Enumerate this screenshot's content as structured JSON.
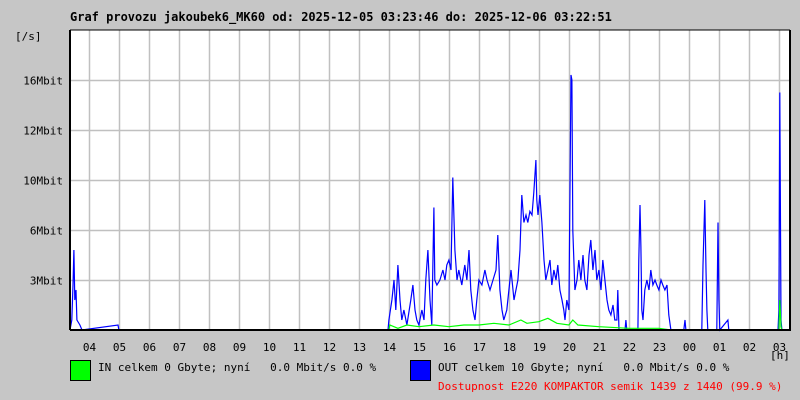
{
  "chart_data": {
    "type": "line",
    "title": "Graf provozu jakoubek6_MK60 od: 2025-12-05 03:23:46 do: 2025-12-06 03:22:51",
    "ylabel": "[/s]",
    "xlabel": "[h]",
    "y_ticks": [
      {
        "value": 3,
        "label": "3Mbit"
      },
      {
        "value": 6,
        "label": "6Mbit"
      },
      {
        "value": 10,
        "label": "10Mbit"
      },
      {
        "value": 12,
        "label": "12Mbit"
      },
      {
        "value": 16,
        "label": "16Mbit"
      }
    ],
    "y_scale_breaks": [
      0,
      3,
      6,
      10,
      12,
      16,
      20
    ],
    "x_range_hours": [
      3.37,
      27.37
    ],
    "x_ticks": [
      {
        "t": 4,
        "label": "04"
      },
      {
        "t": 5,
        "label": "05"
      },
      {
        "t": 6,
        "label": "06"
      },
      {
        "t": 7,
        "label": "07"
      },
      {
        "t": 8,
        "label": "08"
      },
      {
        "t": 9,
        "label": "09"
      },
      {
        "t": 10,
        "label": "10"
      },
      {
        "t": 11,
        "label": "11"
      },
      {
        "t": 12,
        "label": "12"
      },
      {
        "t": 13,
        "label": "13"
      },
      {
        "t": 14,
        "label": "14"
      },
      {
        "t": 15,
        "label": "15"
      },
      {
        "t": 16,
        "label": "16"
      },
      {
        "t": 17,
        "label": "17"
      },
      {
        "t": 18,
        "label": "18"
      },
      {
        "t": 19,
        "label": "19"
      },
      {
        "t": 20,
        "label": "20"
      },
      {
        "t": 21,
        "label": "21"
      },
      {
        "t": 22,
        "label": "22"
      },
      {
        "t": 23,
        "label": "23"
      },
      {
        "t": 24,
        "label": "00"
      },
      {
        "t": 25,
        "label": "01"
      },
      {
        "t": 26,
        "label": "02"
      },
      {
        "t": 27,
        "label": "03"
      }
    ],
    "grid": true,
    "series": [
      {
        "name": "OUT",
        "color": "#0000ff",
        "unit": "Mbit/s",
        "points": [
          [
            3.37,
            0
          ],
          [
            3.43,
            0.6
          ],
          [
            3.47,
            2.7
          ],
          [
            3.5,
            4.8
          ],
          [
            3.53,
            1.8
          ],
          [
            3.57,
            2.4
          ],
          [
            3.6,
            0.6
          ],
          [
            3.7,
            0.3
          ],
          [
            3.77,
            0
          ],
          [
            4.97,
            0.3
          ],
          [
            5.0,
            0
          ],
          [
            13.97,
            0
          ],
          [
            14.0,
            0.6
          ],
          [
            14.1,
            1.8
          ],
          [
            14.17,
            3.0
          ],
          [
            14.23,
            1.2
          ],
          [
            14.3,
            3.9
          ],
          [
            14.37,
            1.8
          ],
          [
            14.43,
            0.6
          ],
          [
            14.5,
            1.2
          ],
          [
            14.6,
            0.3
          ],
          [
            14.73,
            1.8
          ],
          [
            14.8,
            2.7
          ],
          [
            14.87,
            1.2
          ],
          [
            14.93,
            0.6
          ],
          [
            15.0,
            0.3
          ],
          [
            15.1,
            1.2
          ],
          [
            15.17,
            0.6
          ],
          [
            15.23,
            3.0
          ],
          [
            15.3,
            4.8
          ],
          [
            15.37,
            1.8
          ],
          [
            15.43,
            0.3
          ],
          [
            15.5,
            7.8
          ],
          [
            15.53,
            3.0
          ],
          [
            15.6,
            2.7
          ],
          [
            15.7,
            3.0
          ],
          [
            15.8,
            3.6
          ],
          [
            15.87,
            3.0
          ],
          [
            15.93,
            3.9
          ],
          [
            16.0,
            4.2
          ],
          [
            16.07,
            3.6
          ],
          [
            16.13,
            10.1
          ],
          [
            16.2,
            4.8
          ],
          [
            16.27,
            3.0
          ],
          [
            16.33,
            3.6
          ],
          [
            16.43,
            2.7
          ],
          [
            16.53,
            3.9
          ],
          [
            16.6,
            3.0
          ],
          [
            16.67,
            4.8
          ],
          [
            16.73,
            2.4
          ],
          [
            16.8,
            1.2
          ],
          [
            16.87,
            0.6
          ],
          [
            16.93,
            1.8
          ],
          [
            17.0,
            3.0
          ],
          [
            17.1,
            2.7
          ],
          [
            17.2,
            3.6
          ],
          [
            17.27,
            3.0
          ],
          [
            17.37,
            2.4
          ],
          [
            17.47,
            3.0
          ],
          [
            17.57,
            3.6
          ],
          [
            17.63,
            5.7
          ],
          [
            17.7,
            2.4
          ],
          [
            17.77,
            1.2
          ],
          [
            17.83,
            0.6
          ],
          [
            17.93,
            1.2
          ],
          [
            18.0,
            2.4
          ],
          [
            18.07,
            3.6
          ],
          [
            18.17,
            1.8
          ],
          [
            18.3,
            3.0
          ],
          [
            18.37,
            4.8
          ],
          [
            18.43,
            8.8
          ],
          [
            18.5,
            6.6
          ],
          [
            18.57,
            7.2
          ],
          [
            18.63,
            6.6
          ],
          [
            18.7,
            7.5
          ],
          [
            18.77,
            7.2
          ],
          [
            18.83,
            9.0
          ],
          [
            18.9,
            10.8
          ],
          [
            18.93,
            8.4
          ],
          [
            18.97,
            7.2
          ],
          [
            19.03,
            8.8
          ],
          [
            19.1,
            6.6
          ],
          [
            19.17,
            4.2
          ],
          [
            19.23,
            3.0
          ],
          [
            19.3,
            3.6
          ],
          [
            19.37,
            4.2
          ],
          [
            19.43,
            2.7
          ],
          [
            19.5,
            3.6
          ],
          [
            19.57,
            3.0
          ],
          [
            19.63,
            3.9
          ],
          [
            19.7,
            2.4
          ],
          [
            19.77,
            1.8
          ],
          [
            19.83,
            1.2
          ],
          [
            19.87,
            0.6
          ],
          [
            19.93,
            1.8
          ],
          [
            20.0,
            1.2
          ],
          [
            20.07,
            16.4
          ],
          [
            20.1,
            16.0
          ],
          [
            20.13,
            6.0
          ],
          [
            20.2,
            2.4
          ],
          [
            20.27,
            3.0
          ],
          [
            20.33,
            4.2
          ],
          [
            20.4,
            3.0
          ],
          [
            20.47,
            4.5
          ],
          [
            20.53,
            3.0
          ],
          [
            20.6,
            2.4
          ],
          [
            20.67,
            4.5
          ],
          [
            20.73,
            5.4
          ],
          [
            20.8,
            3.6
          ],
          [
            20.87,
            4.8
          ],
          [
            20.93,
            3.0
          ],
          [
            21.0,
            3.6
          ],
          [
            21.07,
            2.4
          ],
          [
            21.13,
            4.2
          ],
          [
            21.2,
            3.0
          ],
          [
            21.27,
            1.8
          ],
          [
            21.33,
            1.2
          ],
          [
            21.4,
            0.9
          ],
          [
            21.47,
            1.5
          ],
          [
            21.53,
            0.6
          ],
          [
            21.6,
            0.6
          ],
          [
            21.63,
            2.4
          ],
          [
            21.67,
            0
          ],
          [
            21.87,
            0
          ],
          [
            21.9,
            0.6
          ],
          [
            21.93,
            0
          ],
          [
            22.3,
            0
          ],
          [
            22.33,
            4.2
          ],
          [
            22.37,
            8.0
          ],
          [
            22.4,
            5.0
          ],
          [
            22.43,
            1.2
          ],
          [
            22.47,
            0.6
          ],
          [
            22.53,
            2.4
          ],
          [
            22.6,
            3.0
          ],
          [
            22.67,
            2.4
          ],
          [
            22.73,
            3.6
          ],
          [
            22.8,
            2.7
          ],
          [
            22.87,
            3.0
          ],
          [
            22.93,
            2.7
          ],
          [
            23.0,
            2.4
          ],
          [
            23.07,
            3.0
          ],
          [
            23.13,
            2.7
          ],
          [
            23.2,
            2.4
          ],
          [
            23.27,
            2.7
          ],
          [
            23.33,
            0.9
          ],
          [
            23.4,
            0
          ],
          [
            23.83,
            0
          ],
          [
            23.87,
            0.6
          ],
          [
            23.9,
            0
          ],
          [
            24.43,
            0
          ],
          [
            24.47,
            3.9
          ],
          [
            24.53,
            8.4
          ],
          [
            24.57,
            3.6
          ],
          [
            24.6,
            1.2
          ],
          [
            24.63,
            0
          ],
          [
            24.93,
            0
          ],
          [
            24.97,
            6.6
          ],
          [
            25.0,
            1.8
          ],
          [
            25.03,
            0
          ],
          [
            25.3,
            0.6
          ],
          [
            25.33,
            0
          ],
          [
            26.97,
            0
          ],
          [
            27.0,
            1.2
          ],
          [
            27.03,
            15.0
          ],
          [
            27.07,
            0.6
          ],
          [
            27.1,
            0
          ]
        ]
      },
      {
        "name": "IN",
        "color": "#00ff00",
        "unit": "Mbit/s",
        "points": [
          [
            3.37,
            0
          ],
          [
            14.0,
            0
          ],
          [
            14.03,
            0.3
          ],
          [
            14.3,
            0.1
          ],
          [
            14.6,
            0.3
          ],
          [
            15.0,
            0.2
          ],
          [
            15.5,
            0.3
          ],
          [
            16.0,
            0.2
          ],
          [
            16.5,
            0.3
          ],
          [
            17.0,
            0.3
          ],
          [
            17.5,
            0.4
          ],
          [
            18.0,
            0.3
          ],
          [
            18.4,
            0.6
          ],
          [
            18.6,
            0.4
          ],
          [
            19.0,
            0.5
          ],
          [
            19.3,
            0.7
          ],
          [
            19.6,
            0.4
          ],
          [
            20.0,
            0.3
          ],
          [
            20.13,
            0.6
          ],
          [
            20.3,
            0.3
          ],
          [
            21.0,
            0.2
          ],
          [
            22.0,
            0.1
          ],
          [
            23.0,
            0.1
          ],
          [
            23.4,
            0
          ],
          [
            27.0,
            0
          ],
          [
            27.03,
            1.8
          ],
          [
            27.07,
            0.2
          ],
          [
            27.1,
            0
          ]
        ]
      }
    ]
  },
  "legend": {
    "in_text": "IN celkem 0 Gbyte; nyní   0.0 Mbit/s 0.0 %",
    "out_text": "OUT celkem 10 Gbyte; nyní   0.0 Mbit/s 0.0 %",
    "in_color": "#00ff00",
    "out_color": "#0000ff"
  },
  "availability": {
    "text": "Dostupnost E220 KOMPAKTOR semik 1439 z 1440 (99.9 %)",
    "color": "#ff0000"
  }
}
